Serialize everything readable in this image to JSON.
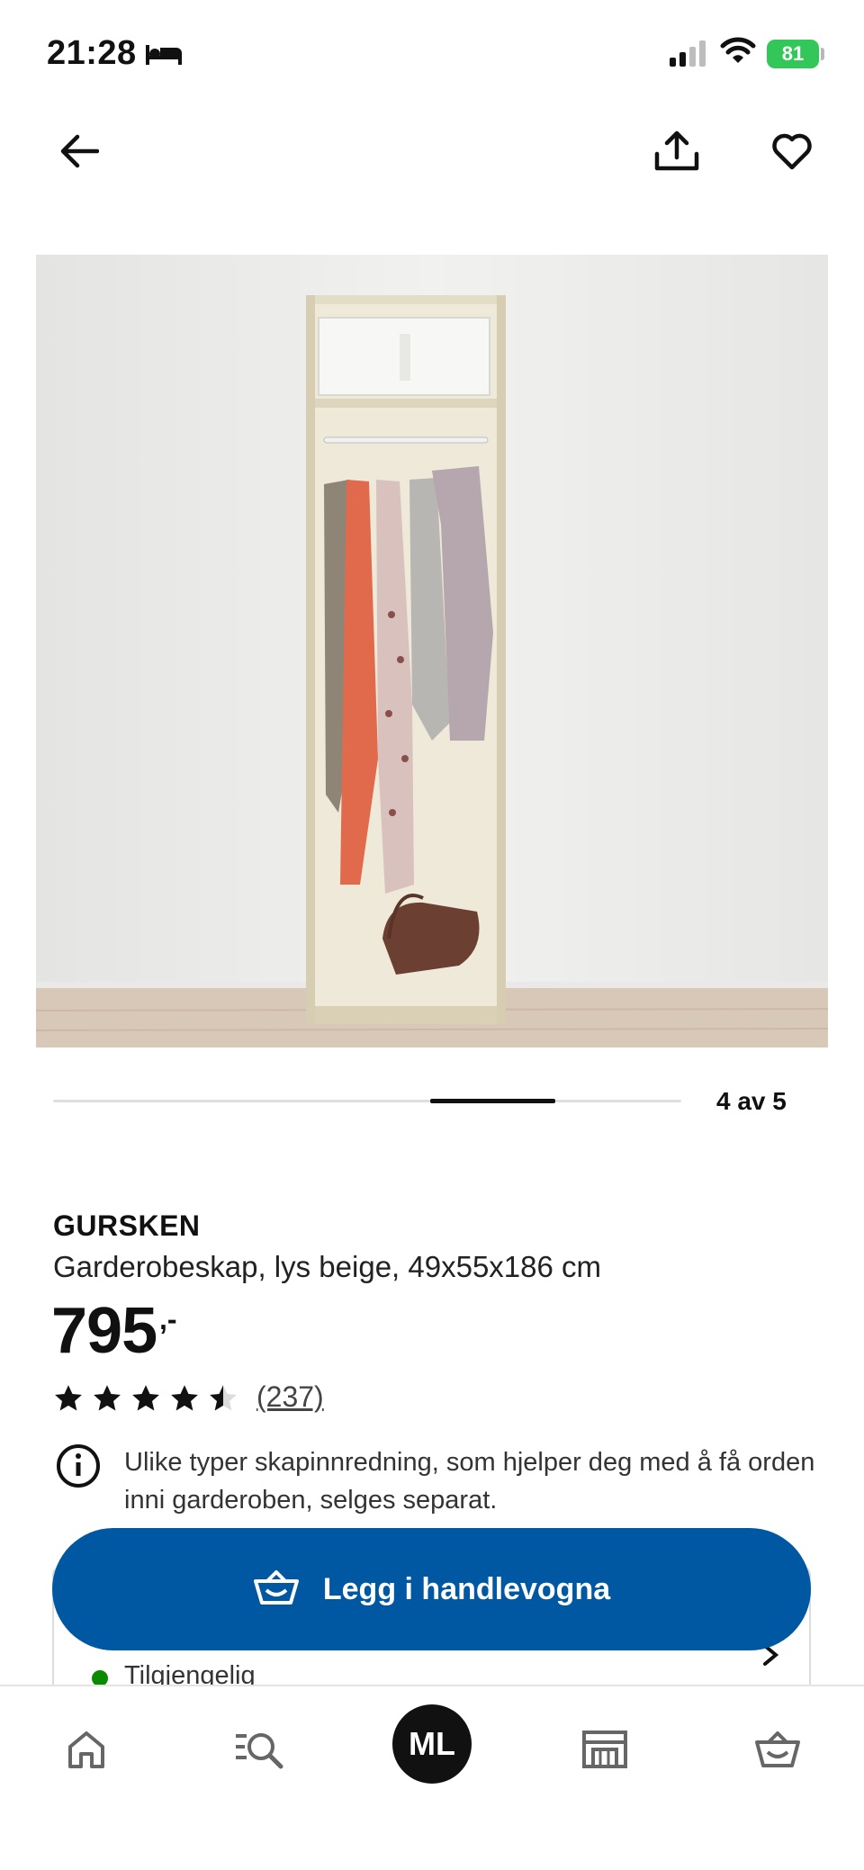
{
  "status_bar": {
    "time": "21:28",
    "battery": "81",
    "icons": [
      "bed-icon",
      "signal-icon",
      "wifi-icon",
      "battery-icon"
    ]
  },
  "top_nav": {
    "icons": [
      "back-arrow-icon",
      "share-icon",
      "heart-icon"
    ]
  },
  "gallery": {
    "counter": "4 av 5",
    "current": 4,
    "total": 5
  },
  "product": {
    "name": "GURSKEN",
    "description": "Garderobeskap, lys beige, 49x55x186 cm",
    "price": "795",
    "price_suffix": ",-",
    "rating": 4.5,
    "review_count": "(237)",
    "info_note": "Ulike typer skapinnredning, som hjelper deg med å få orden inni garderoben, selges separat."
  },
  "availability": {
    "label": "Tilgjengelig",
    "status_color": "#0a8a00"
  },
  "cart_button": {
    "label": "Legg i handlevogna",
    "color": "#0058a3"
  },
  "bottom_nav": {
    "items": [
      "home-icon",
      "search-icon",
      "profile-avatar",
      "store-icon",
      "cart-icon"
    ],
    "profile_initials": "ML"
  }
}
